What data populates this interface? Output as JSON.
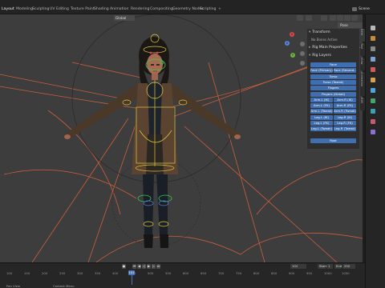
{
  "workspace_tabs": [
    {
      "label": "Layout",
      "active": true
    },
    {
      "label": "Modeling",
      "active": false
    },
    {
      "label": "Sculpting",
      "active": false
    },
    {
      "label": "UV Editing",
      "active": false
    },
    {
      "label": "Texture Paint",
      "active": false
    },
    {
      "label": "Shading",
      "active": false
    },
    {
      "label": "Animation",
      "active": false
    },
    {
      "label": "Rendering",
      "active": false
    },
    {
      "label": "Compositing",
      "active": false
    },
    {
      "label": "Geometry Nodes",
      "active": false
    },
    {
      "label": "Scripting",
      "active": false
    },
    {
      "label": "+",
      "active": false
    }
  ],
  "scene": {
    "label": "Scene"
  },
  "viewport": {
    "orientation": "Global",
    "pose_options": "Pose Options",
    "gizmo": {
      "x": "X",
      "y": "Y",
      "z": "Z"
    }
  },
  "npanel": {
    "transform_header": "Transform",
    "no_bones": "No Bones Active",
    "rig_main_header": "Rig Main Properties",
    "rig_layers_header": "Rig Layers",
    "layers": [
      {
        "label": "Face",
        "row": 0,
        "col": "full"
      },
      {
        "label": "Face (Primary)",
        "row": 1,
        "col": "left"
      },
      {
        "label": "Face (Second...",
        "row": 1,
        "col": "right"
      },
      {
        "label": "Torso",
        "row": 2,
        "col": "full"
      },
      {
        "label": "Torso (Tweak)",
        "row": 3,
        "col": "full"
      },
      {
        "label": "Fingers",
        "row": 4,
        "col": "full"
      },
      {
        "label": "Fingers (Detail)",
        "row": 5,
        "col": "full"
      },
      {
        "label": "Arm.L (IK)",
        "row": 6,
        "col": "left"
      },
      {
        "label": "Arm.R (IK)",
        "row": 6,
        "col": "right"
      },
      {
        "label": "Arm.L (FK)",
        "row": 7,
        "col": "left"
      },
      {
        "label": "Arm.R (FK)",
        "row": 7,
        "col": "right"
      },
      {
        "label": "Arm.L (Tweak)",
        "row": 8,
        "col": "left"
      },
      {
        "label": "Arm.R (Tweak)",
        "row": 8,
        "col": "right"
      },
      {
        "label": "Leg.L (IK)",
        "row": 9,
        "col": "left"
      },
      {
        "label": "Leg.R (IK)",
        "row": 9,
        "col": "right"
      },
      {
        "label": "Leg.L (FK)",
        "row": 10,
        "col": "left"
      },
      {
        "label": "Leg.R (FK)",
        "row": 10,
        "col": "right"
      },
      {
        "label": "Leg.L (Tweak)",
        "row": 11,
        "col": "left"
      },
      {
        "label": "Leg.R (Tweak)",
        "row": 11,
        "col": "right"
      },
      {
        "label": "Root",
        "row": 13,
        "col": "full"
      }
    ]
  },
  "side_tabs": [
    "Item",
    "Tool",
    "View",
    "Animation",
    "Edit"
  ],
  "timeline": {
    "current_frame": "102",
    "start_label": "Start",
    "start_value": "1",
    "end_label": "End",
    "end_value": "250",
    "frame_field": "102",
    "ticks": [
      "100",
      "150",
      "200",
      "250",
      "300",
      "350",
      "400",
      "450",
      "500",
      "550",
      "600",
      "650",
      "700",
      "750",
      "800",
      "850",
      "900",
      "950",
      "1000",
      "1050"
    ]
  },
  "status": {
    "left": "Pan View",
    "mid": "Context Menu"
  },
  "colors": {
    "accent_blue": "#3f6fb0",
    "viewport_bg": "#3d3d3d",
    "bone_yellow": "#e3c83a",
    "bone_green": "#37c95a"
  }
}
